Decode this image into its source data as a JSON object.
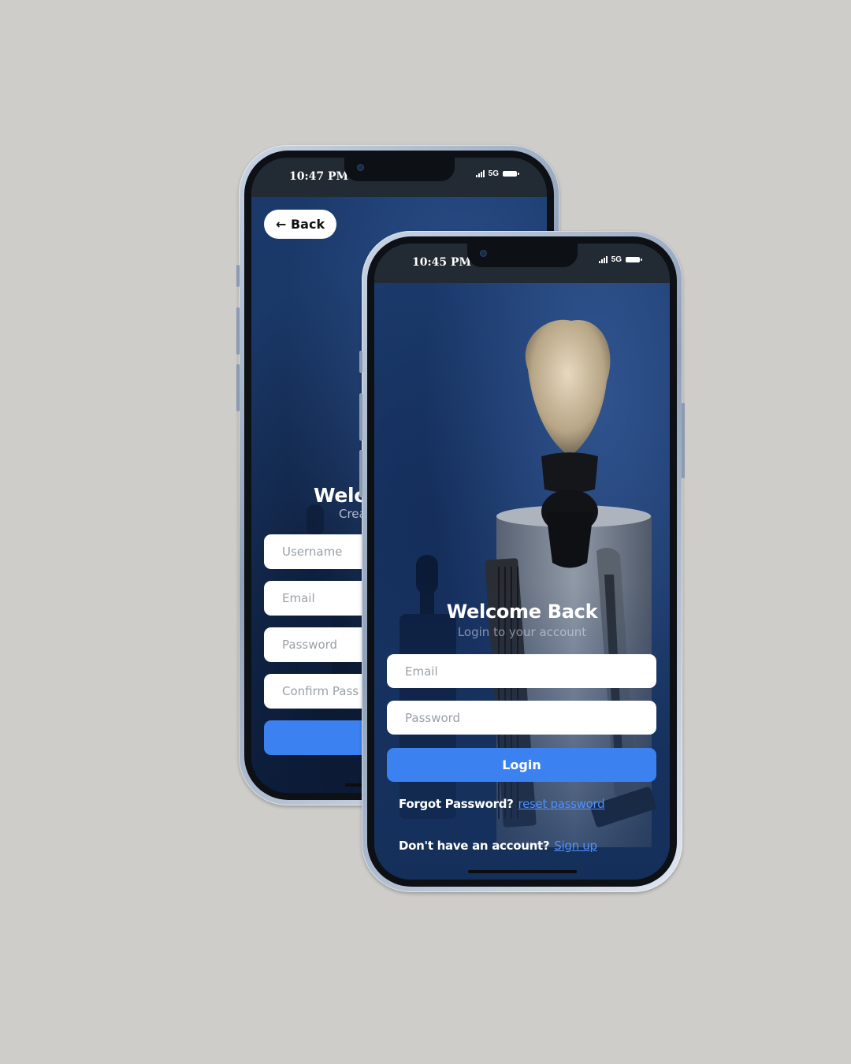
{
  "colors": {
    "page_background": "#cfcdc9",
    "accent_blue": "#3b82f0",
    "link_blue": "#4e90ff",
    "screen_navy": "#1a3766"
  },
  "signup_phone": {
    "status_time": "10:47 PM",
    "network": "5G",
    "back_button": "← Back",
    "title_partial": "Welc",
    "subtitle_partial": "Crea",
    "fields": {
      "username_placeholder": "Username",
      "email_placeholder": "Email",
      "password_placeholder": "Password",
      "confirm_placeholder": "Confirm Pass"
    }
  },
  "login_phone": {
    "status_time": "10:45 PM",
    "network": "5G",
    "title": "Welcome Back",
    "subtitle": "Login to your account",
    "email_placeholder": "Email",
    "password_placeholder": "Password",
    "login_button": "Login",
    "forgot_prompt": "Forgot Password?",
    "reset_link": "reset password",
    "signup_prompt": "Don't have an account?",
    "signup_link": "Sign up"
  },
  "icons": [
    "signal-icon",
    "battery-icon",
    "camera-icon",
    "shaving-brush-image",
    "serum-bottle-image",
    "comb-image",
    "razor-image"
  ]
}
